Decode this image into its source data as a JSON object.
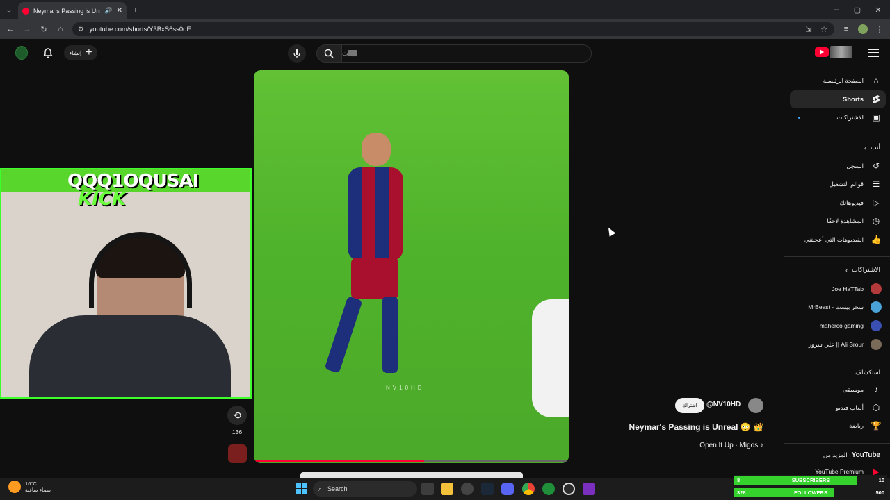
{
  "browser": {
    "tab_title": "Neymar's Passing is Unreal",
    "url": "youtube.com/shorts/Y3BxS6ss0oE"
  },
  "header": {
    "search_placeholder": "بحث",
    "create_label": "إنشاء"
  },
  "sidebar": {
    "main": [
      {
        "label": "الصفحة الرئيسية",
        "icon": "home-icon"
      },
      {
        "label": "Shorts",
        "icon": "shorts-icon",
        "active": true
      },
      {
        "label": "الاشتراكات",
        "icon": "subscriptions-icon"
      }
    ],
    "you_heading": "أنت",
    "you": [
      {
        "label": "السجل",
        "icon": "history-icon"
      },
      {
        "label": "قوائم التشغيل",
        "icon": "playlists-icon"
      },
      {
        "label": "فيديوهاتك",
        "icon": "your-videos-icon"
      },
      {
        "label": "المشاهدة لاحقًا",
        "icon": "watch-later-icon"
      },
      {
        "label": "الفيديوهات التي أعجبتني",
        "icon": "liked-icon"
      }
    ],
    "subs_heading": "الاشتراكات",
    "subscriptions": [
      {
        "label": "Joe HaTTab",
        "color": "#b23a3a"
      },
      {
        "label": "MrBeast - سحر بيست",
        "color": "#4aa3d8"
      },
      {
        "label": "maherco gaming",
        "color": "#3a4fb2"
      },
      {
        "label": "علي سرور || Ali Srour",
        "color": "#7a6a5a"
      }
    ],
    "explore_heading": "استكشاف",
    "explore": [
      {
        "label": "موسيقى",
        "icon": "music-icon"
      },
      {
        "label": "ألعاب فيديو",
        "icon": "gaming-icon"
      },
      {
        "label": "رياضة",
        "icon": "sports-icon"
      }
    ],
    "more_heading_prefix": "المزيد من",
    "more_heading_brand": "YouTube",
    "premium": "YouTube Premium"
  },
  "overlay": {
    "streamer_name": "QQQ1OQUSAI",
    "platform": "KICK"
  },
  "short": {
    "watermark": "NV10HD",
    "progress": 0.54,
    "remix_count": "136",
    "channel_handle": "@NV10HD",
    "subscribe_label": "اشتراك",
    "title": "Neymar's Passing is Unreal 😳 👑",
    "music": "Open It Up · Migos ♪"
  },
  "taskbar": {
    "temperature": "16°C",
    "weather_desc": "سماء صافية",
    "search_label": "Search"
  },
  "widget": {
    "subs_label": "SUBSCRIBERS",
    "subs_current": "8",
    "subs_goal": "10",
    "followers_label": "FOLLOWERS",
    "followers_current": "328",
    "followers_goal": "500"
  }
}
